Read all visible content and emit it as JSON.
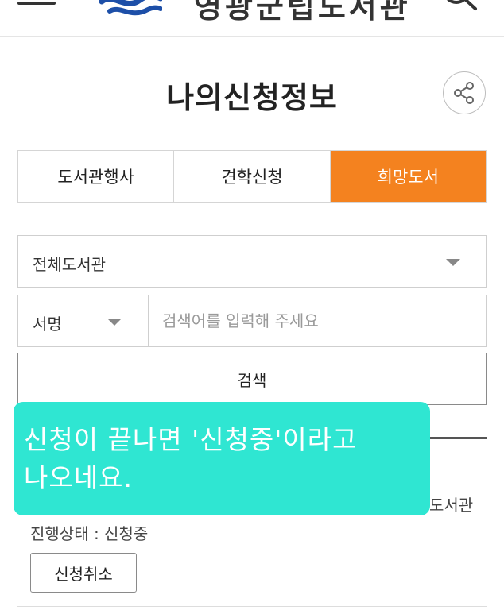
{
  "header": {
    "site_name": "영광군립도서관"
  },
  "page": {
    "title": "나의신청정보"
  },
  "tabs": [
    {
      "label": "도서관행사",
      "active": false
    },
    {
      "label": "견학신청",
      "active": false
    },
    {
      "label": "희망도서",
      "active": true
    }
  ],
  "filters": {
    "library_select": "전체도서관",
    "field_select": "서명",
    "search_placeholder": "검색어를 입력해 주세요",
    "search_value": "",
    "search_button": "검색"
  },
  "result": {
    "library_fragment": "도서관",
    "status": "진행상태 : 신청중",
    "cancel_button": "신청취소"
  },
  "caption": {
    "text": "신청이 끝나면 '신청중'이라고\n나오네요."
  },
  "colors": {
    "active_tab": "#f4821f",
    "caption_bg": "#2fe6d2"
  },
  "icons": {
    "menu": "hamburger-icon",
    "logo": "library-logo",
    "search": "search-icon",
    "share": "share-icon",
    "dropdown": "chevron-down-icon"
  }
}
